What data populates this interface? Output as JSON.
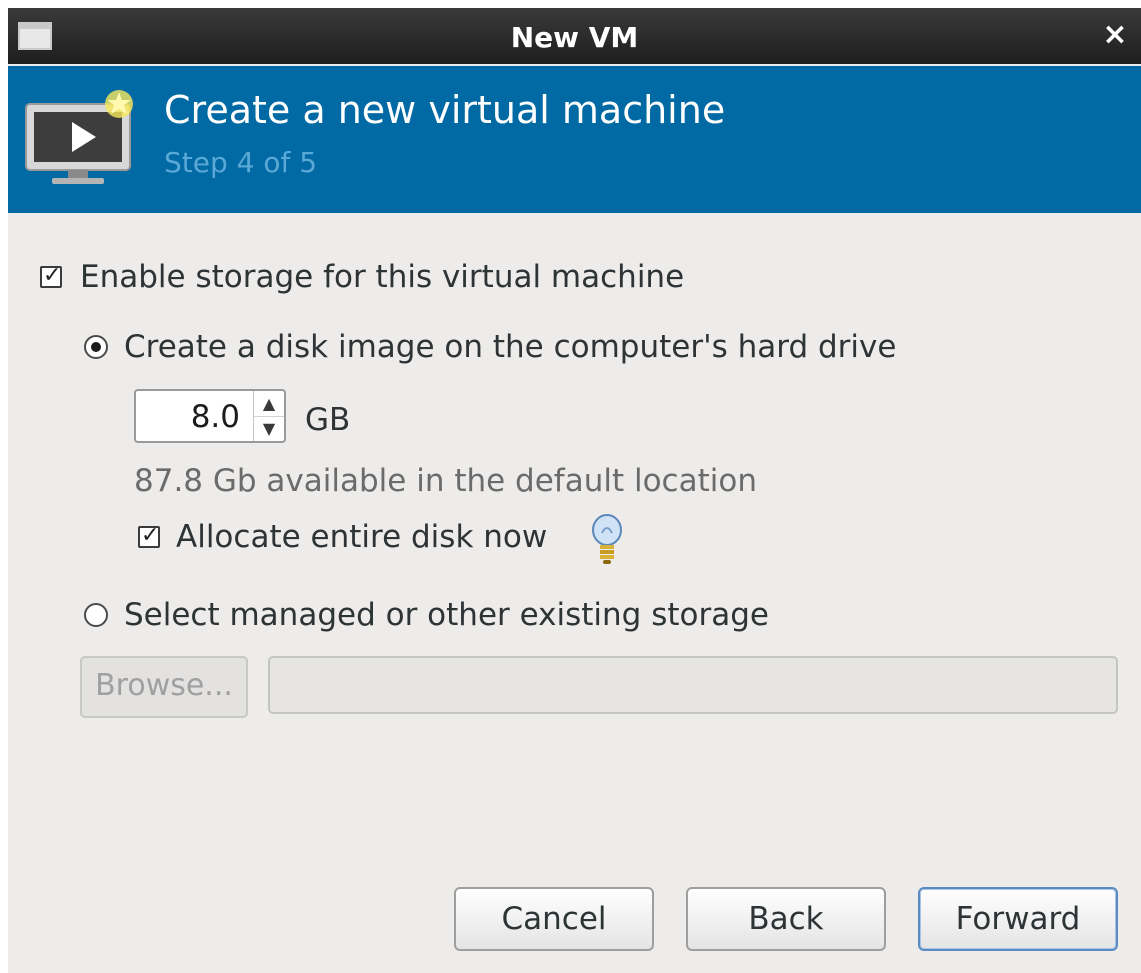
{
  "window": {
    "title": "New VM",
    "close_glyph": "×"
  },
  "header": {
    "title": "Create a new virtual machine",
    "step": "Step 4 of 5"
  },
  "storage": {
    "enable_label": "Enable storage for this virtual machine",
    "enable_checked": true,
    "create_disk_label": "Create a disk image on the computer's hard drive",
    "create_disk_selected": true,
    "size_value": "8.0",
    "size_unit": "GB",
    "available_text": "87.8 Gb available in the default location",
    "allocate_label": "Allocate entire disk now",
    "allocate_checked": true,
    "select_existing_label": "Select managed or other existing storage",
    "select_existing_selected": false,
    "browse_label": "Browse...",
    "path_value": ""
  },
  "buttons": {
    "cancel": "Cancel",
    "back": "Back",
    "forward": "Forward"
  },
  "icons": {
    "window_icon": "window-icon",
    "header_icon": "new-vm-monitor-icon",
    "spin_up": "▲",
    "spin_down": "▼",
    "check": "✓",
    "hint_icon": "lightbulb-icon"
  },
  "colors": {
    "header_bg": "#0169a3",
    "step_text": "#5aa8d5",
    "titlebar_bg": "#2a2a2a",
    "dialog_bg": "#edecea"
  }
}
